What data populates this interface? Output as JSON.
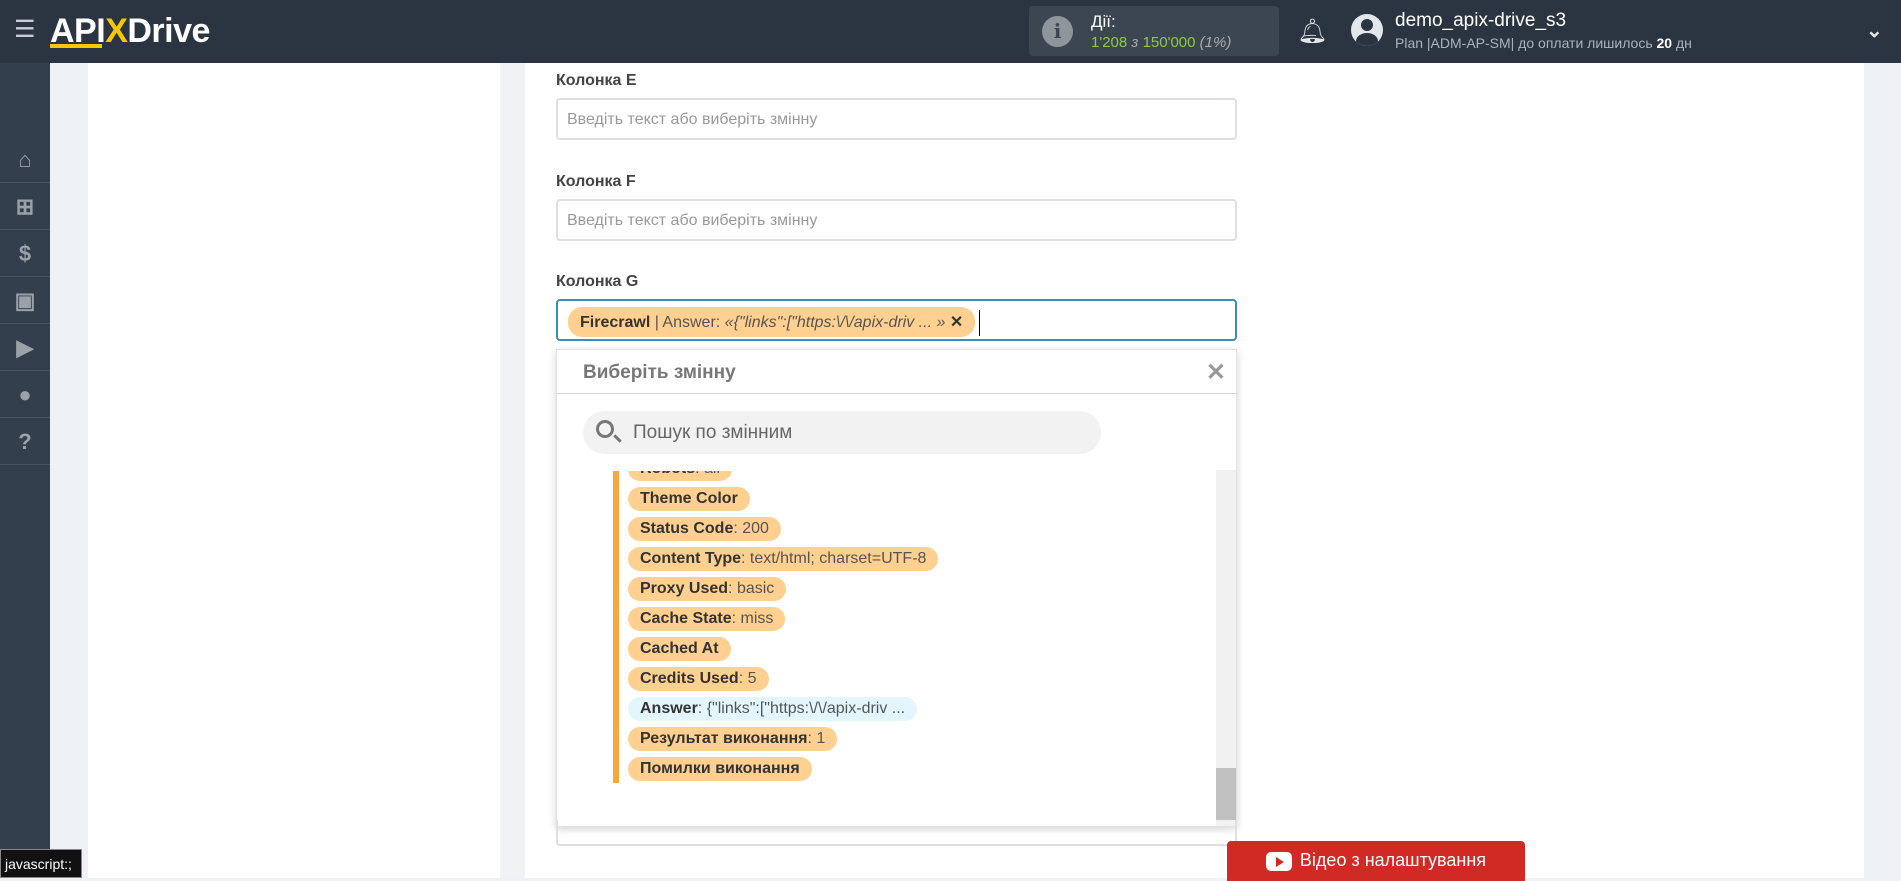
{
  "header": {
    "logo": "APIXDrive",
    "actions_label": "Дії:",
    "actions_count": "1'208",
    "actions_of": "з",
    "actions_total": "150'000",
    "actions_pct": "(1%)",
    "username": "demo_apix-drive_s3",
    "plan_prefix": "Plan |ADM-AP-SM| до оплати лишилось",
    "plan_days": "20",
    "plan_suffix": "дн"
  },
  "sidebar": {
    "items": [
      "home-icon",
      "sitemap-icon",
      "dollar-icon",
      "briefcase-icon",
      "youtube-icon",
      "user-icon",
      "help-icon"
    ]
  },
  "form": {
    "col_e": {
      "label": "Колонка E",
      "placeholder": "Введіть текст або виберіть змінну"
    },
    "col_f": {
      "label": "Колонка F",
      "placeholder": "Введіть текст або виберіть змінну"
    },
    "col_g": {
      "label": "Колонка G",
      "tag_source": "Firecrawl",
      "tag_sep": " | Answer: ",
      "tag_value": "«{\"links\":[\"https:\\/\\/apix-driv ... »"
    }
  },
  "dropdown": {
    "title": "Виберіть змінну",
    "search_placeholder": "Пошук по змінним",
    "items": [
      {
        "name": "Robots",
        "value": "all"
      },
      {
        "name": "Theme Color",
        "value": ""
      },
      {
        "name": "Status Code",
        "value": "200"
      },
      {
        "name": "Content Type",
        "value": "text/html; charset=UTF-8"
      },
      {
        "name": "Proxy Used",
        "value": "basic"
      },
      {
        "name": "Cache State",
        "value": "miss"
      },
      {
        "name": "Cached At",
        "value": ""
      },
      {
        "name": "Credits Used",
        "value": "5"
      },
      {
        "name": "Answer",
        "value": "{\"links\":[\"https:\\/\\/apix-driv ...",
        "selected": true
      },
      {
        "name": "Результат виконання",
        "value": "1"
      },
      {
        "name": "Помилки виконання",
        "value": ""
      }
    ]
  },
  "video_button": "Відео з налаштування",
  "status_bar": "javascript:;",
  "colors": {
    "header": "#2b3541",
    "tag": "#ffd08f",
    "tag_selected": "#e4f6fd",
    "accent_bar": "#f9a63a",
    "video": "#d12a25",
    "focus": "#3a8fb5"
  }
}
